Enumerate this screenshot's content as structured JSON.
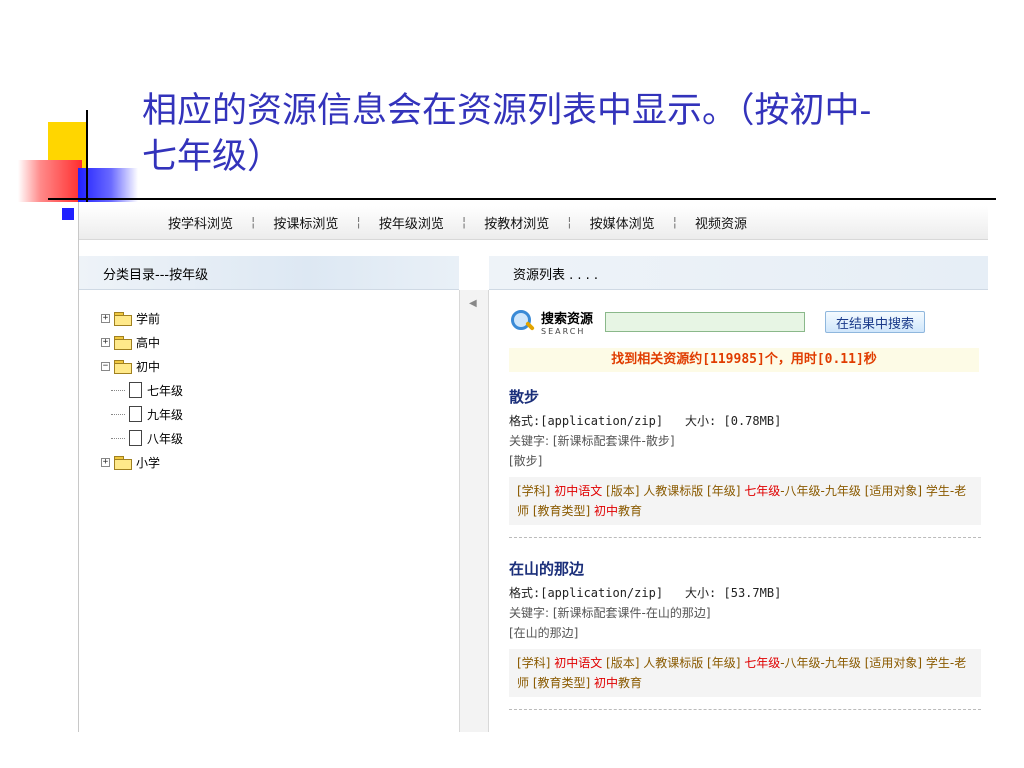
{
  "slide": {
    "title_line1": "相应的资源信息会在资源列表中显示。（按初中-",
    "title_line2": "七年级）"
  },
  "nav": {
    "items": [
      "按学科浏览",
      "按课标浏览",
      "按年级浏览",
      "按教材浏览",
      "按媒体浏览",
      "视频资源"
    ],
    "separator": "¦"
  },
  "left_panel": {
    "header": "分类目录---按年级",
    "tree": [
      {
        "label": "学前",
        "toggle": "+"
      },
      {
        "label": "高中",
        "toggle": "+"
      },
      {
        "label": "初中",
        "toggle": "−"
      },
      {
        "label": "七年级"
      },
      {
        "label": "九年级"
      },
      {
        "label": "八年级"
      },
      {
        "label": "小学",
        "toggle": "+"
      }
    ]
  },
  "right_panel": {
    "header": "资源列表 . . . .",
    "search_title": "搜索资源",
    "search_sub": "SEARCH",
    "search_button": "在结果中搜索",
    "found_text": "找到相关资源约[119985]个，用时[0.11]秒",
    "results": [
      {
        "title": "散步",
        "format": "格式:[application/zip]",
        "size": "大小: [0.78MB]",
        "keywords": "关键字: [新课标配套课件-散步]",
        "bracket": "[散步]",
        "tag_1": "[学科] ",
        "tag_2": "初中语文",
        "tag_3": " [版本] 人教课标版 [年级] ",
        "tag_4": "七年级",
        "tag_5": "-八年级-",
        "tag_6": "九年级 [适用对象] 学生-老师 [教育类型] ",
        "tag_7": "初中",
        "tag_8": "教育"
      },
      {
        "title": "在山的那边",
        "format": "格式:[application/zip]",
        "size": "大小: [53.7MB]",
        "keywords": "关键字: [新课标配套课件-在山的那边]",
        "bracket": "[在山的那边]",
        "tag_1": "[学科] ",
        "tag_2": "初中语文",
        "tag_3": " [版本] 人教课标版 [年级] ",
        "tag_4": "七年级",
        "tag_5": "-八年级-",
        "tag_6": "九年级 [适用对象] 学生-老师 [教育类型] ",
        "tag_7": "初中",
        "tag_8": "教育"
      }
    ]
  },
  "colors": {
    "title_blue": "#3333bb",
    "result_title": "#1b2f7a",
    "found_orange": "#e03c00",
    "highlight_red": "#e00000"
  }
}
